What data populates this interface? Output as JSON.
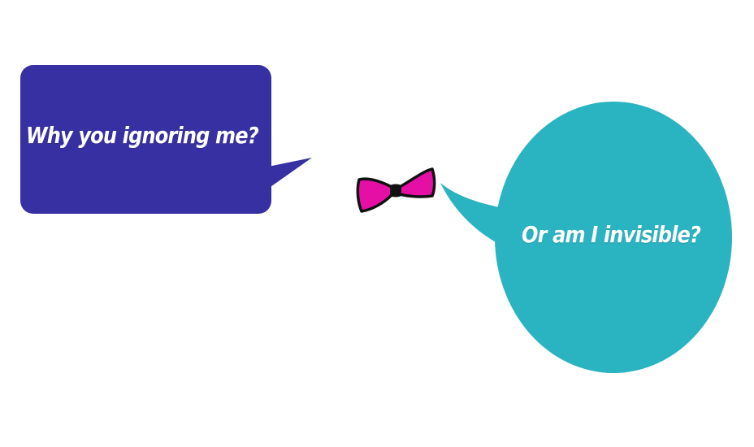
{
  "bubbles": {
    "left": {
      "text": "Why you ignoring me?",
      "color": "#3730a3"
    },
    "right": {
      "text": "Or am I invisible?",
      "color": "#2ab3c1"
    }
  },
  "bow_tie": {
    "icon": "bow-tie-icon",
    "color": "#e60fa5",
    "outline": "#111111"
  }
}
